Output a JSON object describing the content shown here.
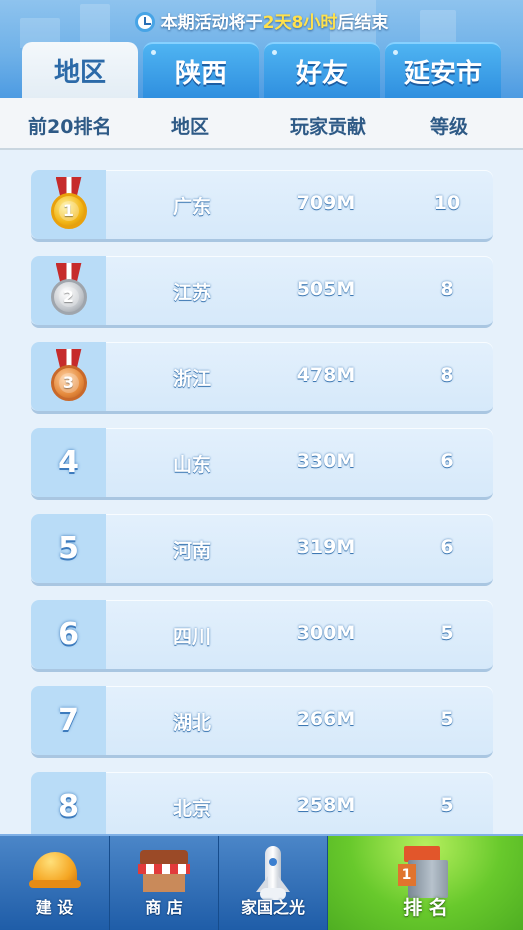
{
  "timer": {
    "prefix": "本期活动将于",
    "highlight": "2天8小时",
    "suffix": "后结束"
  },
  "tabs": [
    {
      "label": "地区",
      "active": true
    },
    {
      "label": "陕西",
      "active": false
    },
    {
      "label": "好友",
      "active": false
    },
    {
      "label": "延安市",
      "active": false
    }
  ],
  "columns": {
    "rank": "前20排名",
    "region": "地区",
    "contribution": "玩家贡献",
    "level": "等级"
  },
  "rows": [
    {
      "rank": "1",
      "medal": "gold-medal",
      "region": "广东",
      "contribution": "709M",
      "level": "10"
    },
    {
      "rank": "2",
      "medal": "silver-medal",
      "region": "江苏",
      "contribution": "505M",
      "level": "8"
    },
    {
      "rank": "3",
      "medal": "bronze-medal",
      "region": "浙江",
      "contribution": "478M",
      "level": "8"
    },
    {
      "rank": "4",
      "region": "山东",
      "contribution": "330M",
      "level": "6"
    },
    {
      "rank": "5",
      "region": "河南",
      "contribution": "319M",
      "level": "6"
    },
    {
      "rank": "6",
      "region": "四川",
      "contribution": "300M",
      "level": "5"
    },
    {
      "rank": "7",
      "region": "湖北",
      "contribution": "266M",
      "level": "5"
    },
    {
      "rank": "8",
      "region": "北京",
      "contribution": "258M",
      "level": "5"
    }
  ],
  "nav": [
    {
      "label": "建 设",
      "icon": "helmet-icon"
    },
    {
      "label": "商 店",
      "icon": "shop-icon"
    },
    {
      "label": "家国之光",
      "icon": "rocket-icon"
    },
    {
      "label": "排 名",
      "icon": "ranking-tower-icon",
      "active": true
    }
  ],
  "colors": {
    "active_tab_text": "#2c6aa8",
    "timer_highlight": "#ffe14d",
    "nav_active": "#68c92c"
  }
}
